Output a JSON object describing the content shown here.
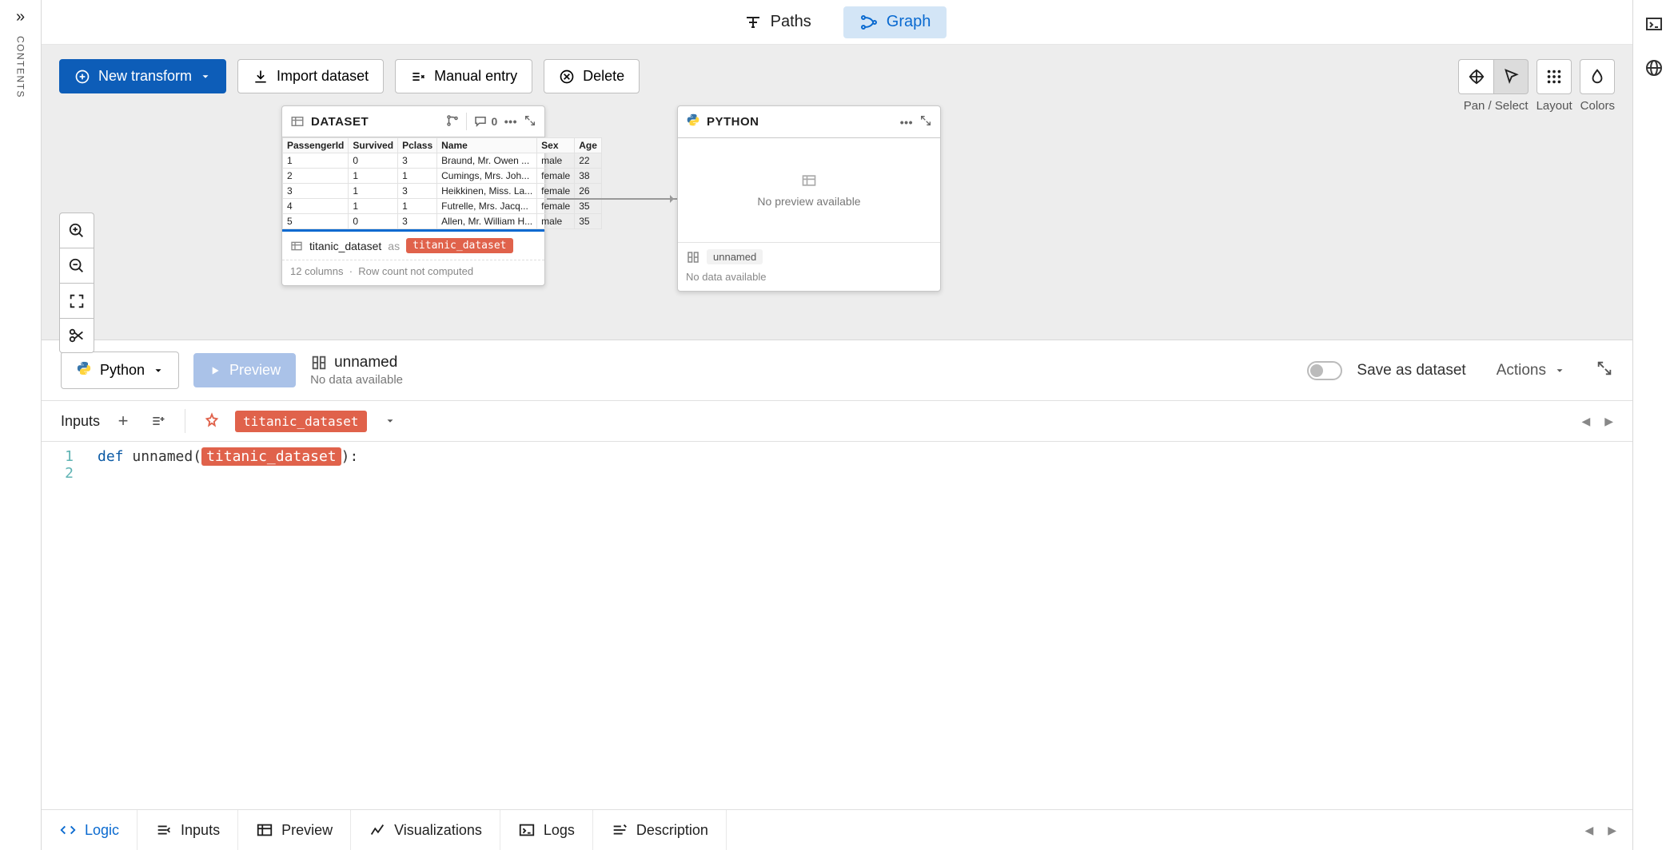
{
  "left_rail": {
    "contents_label": "CONTENTS"
  },
  "top_tabs": {
    "paths": "Paths",
    "graph": "Graph"
  },
  "toolbar": {
    "new_transform": "New transform",
    "import_dataset": "Import dataset",
    "manual_entry": "Manual entry",
    "delete": "Delete"
  },
  "right_tools": {
    "pan_select": "Pan / Select",
    "layout": "Layout",
    "colors": "Colors"
  },
  "dataset_node": {
    "title": "DATASET",
    "comment_count": "0",
    "columns": [
      "PassengerId",
      "Survived",
      "Pclass",
      "Name",
      "Sex",
      "Age"
    ],
    "rows": [
      [
        "1",
        "0",
        "3",
        "Braund, Mr. Owen ...",
        "male",
        "22"
      ],
      [
        "2",
        "1",
        "1",
        "Cumings, Mrs. Joh...",
        "female",
        "38"
      ],
      [
        "3",
        "1",
        "3",
        "Heikkinen, Miss. La...",
        "female",
        "26"
      ],
      [
        "4",
        "1",
        "1",
        "Futrelle, Mrs. Jacq...",
        "female",
        "35"
      ],
      [
        "5",
        "0",
        "3",
        "Allen, Mr. William H...",
        "male",
        "35"
      ]
    ],
    "footer_name": "titanic_dataset",
    "footer_as": "as",
    "footer_tag": "titanic_dataset",
    "subfooter_cols": "12 columns",
    "subfooter_rows": "Row count not computed"
  },
  "python_node": {
    "title": "PYTHON",
    "no_preview": "No preview available",
    "footer_tag": "unnamed",
    "subfooter": "No data available"
  },
  "editor": {
    "lang": "Python",
    "preview_btn": "Preview",
    "name": "unnamed",
    "sub": "No data available",
    "save_as": "Save as dataset",
    "actions": "Actions"
  },
  "inputs": {
    "label": "Inputs",
    "tag": "titanic_dataset"
  },
  "code": {
    "line1_def": "def",
    "line1_name": "unnamed",
    "line1_arg": "titanic_dataset"
  },
  "bottom_tabs": {
    "logic": "Logic",
    "inputs": "Inputs",
    "preview": "Preview",
    "visualizations": "Visualizations",
    "logs": "Logs",
    "description": "Description"
  }
}
